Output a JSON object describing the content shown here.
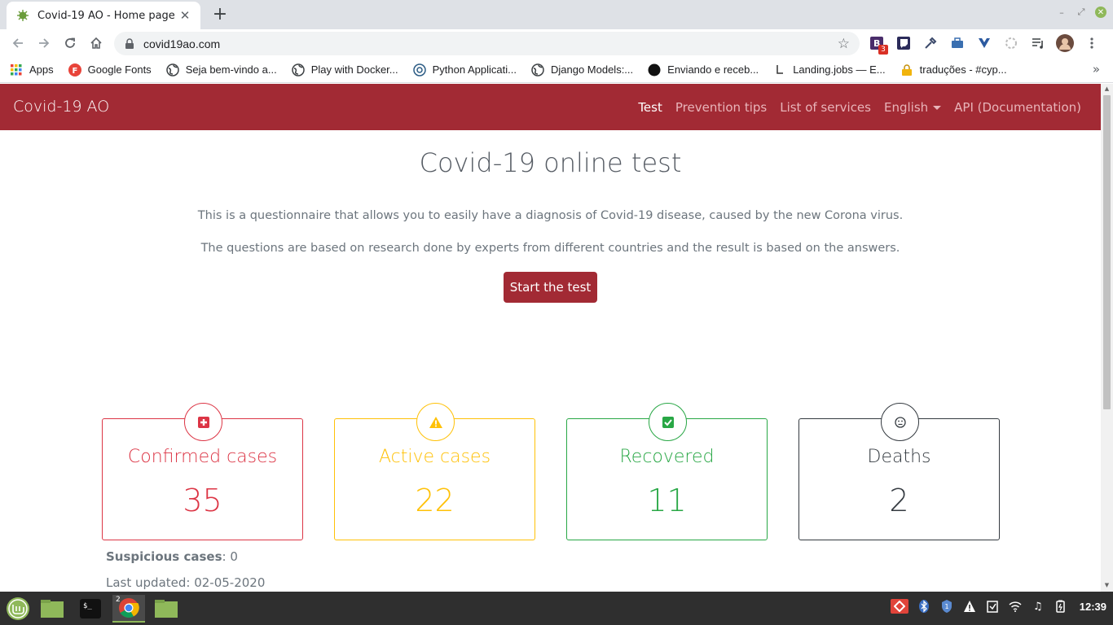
{
  "browser": {
    "tab_title": "Covid-19 AO - Home page",
    "url": "covid19ao.com",
    "new_tab_symbol": "+",
    "extension_badge": "3",
    "bookmarks": [
      {
        "label": "Apps",
        "icon": "apps-grid-icon"
      },
      {
        "label": "Google Fonts",
        "icon": "google-fonts-icon"
      },
      {
        "label": "Seja bem-vindo a...",
        "icon": "globe-icon"
      },
      {
        "label": "Play with Docker...",
        "icon": "globe-icon"
      },
      {
        "label": "Python Applicati...",
        "icon": "python-icon"
      },
      {
        "label": "Django Models:...",
        "icon": "globe-icon"
      },
      {
        "label": "Enviando e receb...",
        "icon": "dark-circle-icon"
      },
      {
        "label": "Landing.jobs — E...",
        "icon": "landing-jobs-icon"
      },
      {
        "label": "traduções - #cyp...",
        "icon": "lock-icon"
      }
    ]
  },
  "site": {
    "brand": "Covid-19 AO",
    "nav": {
      "test": "Test",
      "prevention": "Prevention tips",
      "services": "List of services",
      "language": "English",
      "api": "API (Documentation)"
    },
    "hero": {
      "title": "Covid-19 online test",
      "paragraph1": "This is a questionnaire that allows you to easily have a diagnosis of Covid-19 disease, caused by the new Corona virus.",
      "paragraph2": "The questions are based on research done by experts from different countries and the result is based on the answers.",
      "button": "Start the test"
    },
    "stats": [
      {
        "label": "Confirmed cases",
        "value": "35",
        "color": "#dc3545",
        "icon": "plus-square-icon"
      },
      {
        "label": "Active cases",
        "value": "22",
        "color": "#ffc107",
        "icon": "warning-icon"
      },
      {
        "label": "Recovered",
        "value": "11",
        "color": "#28a745",
        "icon": "check-square-icon"
      },
      {
        "label": "Deaths",
        "value": "2",
        "color": "#343a40",
        "icon": "sad-face-icon"
      }
    ],
    "suspicious_label": "Suspicious cases",
    "suspicious_value": ": 0",
    "last_updated": "Last updated: 02-05-2020"
  },
  "taskbar": {
    "chrome_window_count": "2",
    "time": "12:39"
  }
}
